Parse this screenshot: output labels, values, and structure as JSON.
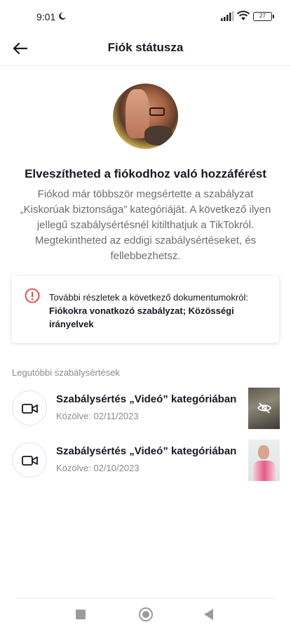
{
  "status_bar": {
    "time": "9:01",
    "battery": "27",
    "icons": [
      "moon-icon",
      "signal-icon",
      "wifi-icon",
      "battery-icon"
    ]
  },
  "header": {
    "title": "Fiók státusza",
    "back_icon": "arrow-left-icon"
  },
  "warning": {
    "title": "Elveszítheted a fiókodhoz való hozzáférést",
    "description": "Fiókod már többször megsértette a szabályzat „Kiskorúak biztonsága” kategóriáját. A következő ilyen jellegű szabálysértésnél kitilthatjuk a TikTokról. Megtekintheted az eddigi szabálysértéseket, és fellebbezhetsz."
  },
  "info_card": {
    "icon": "exclamation-circle-icon",
    "text": "További részletek a következő dokumentumokról:",
    "links": "Fiókokra vonatkozó szabályzat; Közösségi irányelvek"
  },
  "recent": {
    "label": "Legutóbbi szabálysértések",
    "items": [
      {
        "title": "Szabálysértés „Videó” kategóriában",
        "date": "Közölve: 02/11/2023",
        "icon": "video-camera-icon",
        "thumbnail": "hidden-content-thumbnail"
      },
      {
        "title": "Szabálysértés „Videó” kategóriában",
        "date": "Közölve: 02/10/2023",
        "icon": "video-camera-icon",
        "thumbnail": "video-thumbnail"
      }
    ]
  },
  "colors": {
    "text_primary": "#161823",
    "text_secondary": "#6b6c72",
    "alert_red": "#e0413a"
  }
}
